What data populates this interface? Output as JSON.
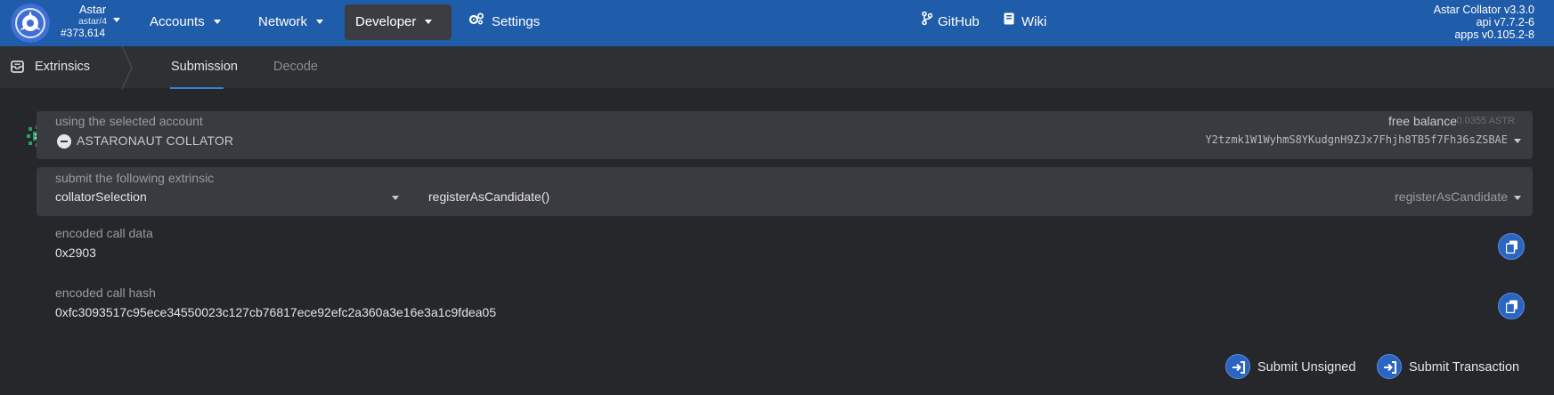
{
  "header": {
    "chain_name": "Astar",
    "chain_spec": "astar/4",
    "block_number": "#373,614",
    "nav": [
      {
        "label": "Accounts"
      },
      {
        "label": "Network"
      },
      {
        "label": "Developer"
      },
      {
        "label": "Settings"
      },
      {
        "label": "GitHub"
      },
      {
        "label": "Wiki"
      }
    ],
    "versions": [
      "Astar Collator v3.3.0",
      "api v7.7.2-6",
      "apps v0.105.2-8"
    ],
    "brand_color": "#1f5ca9",
    "active_menu_color": "#3b3d42"
  },
  "tabs": {
    "root": "Extrinsics",
    "items": [
      {
        "label": "Submission",
        "active": true
      },
      {
        "label": "Decode",
        "active": false
      }
    ]
  },
  "account": {
    "label": "using the selected account",
    "name": "ASTARONAUT COLLATOR",
    "free_balance_label": "free balance",
    "free_balance_value": "0.0355 ASTR",
    "address": "Y2tzmk1W1WyhmS8YKudgnH9ZJx7Fhjh8TB5f7Fh36sZSBAE"
  },
  "extrinsic": {
    "label": "submit the following extrinsic",
    "section": "collatorSelection",
    "method": "registerAsCandidate()",
    "method_short": "registerAsCandidate"
  },
  "encoded_call_data": {
    "label": "encoded call data",
    "value": "0x2903"
  },
  "encoded_call_hash": {
    "label": "encoded call hash",
    "value": "0xfc3093517c95ece34550023c127cb76817ece92efc2a360a3e16e3a1c9fdea05"
  },
  "actions": {
    "submit_unsigned": "Submit Unsigned",
    "submit_transaction": "Submit Transaction"
  }
}
